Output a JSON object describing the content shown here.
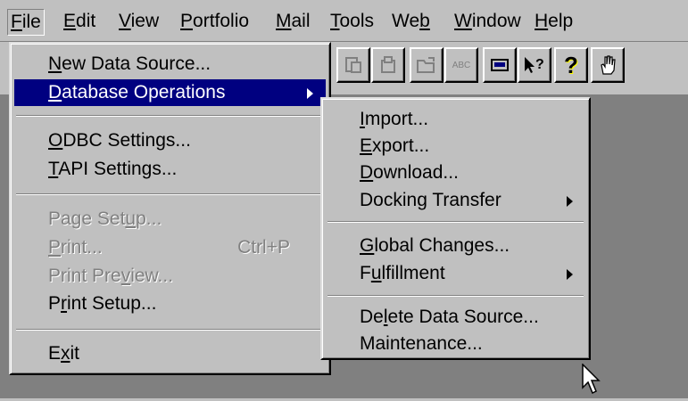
{
  "menubar": {
    "items": [
      {
        "label": "File",
        "underline": "F"
      },
      {
        "label": "Edit",
        "underline": "E"
      },
      {
        "label": "View",
        "underline": "V"
      },
      {
        "label": "Portfolio",
        "underline": "P"
      },
      {
        "label": "Mail",
        "underline": "M"
      },
      {
        "label": "Tools",
        "underline": "T"
      },
      {
        "label": "Web",
        "underline": "b"
      },
      {
        "label": "Window",
        "underline": "W"
      },
      {
        "label": "Help",
        "underline": "H"
      }
    ]
  },
  "toolbar": {
    "buttons": [
      "paste-icon",
      "copy-icon",
      "open-folder-icon",
      "spellcheck-icon",
      "print-icon",
      "context-help-icon",
      "help-icon",
      "hand-icon"
    ],
    "spellcheck_text": "ABC",
    "help_text": "?"
  },
  "file_menu": {
    "items": [
      {
        "label": "New Data Source...",
        "underline": "N",
        "state": "normal"
      },
      {
        "label": "Database Operations",
        "underline": "D",
        "state": "highlighted",
        "submenu": true
      },
      {
        "label": "ODBC Settings...",
        "underline": "O",
        "state": "normal"
      },
      {
        "label": "TAPI Settings...",
        "underline": "T",
        "state": "normal"
      },
      {
        "label": "Page Setup...",
        "underline": "u",
        "state": "disabled"
      },
      {
        "label": "Print...",
        "underline": "P",
        "state": "disabled",
        "shortcut": "Ctrl+P"
      },
      {
        "label": "Print Preview...",
        "underline": "v",
        "state": "disabled"
      },
      {
        "label": "Print Setup...",
        "underline": "r",
        "state": "normal"
      },
      {
        "label": "Exit",
        "underline": "x",
        "state": "normal"
      }
    ]
  },
  "db_submenu": {
    "items": [
      {
        "label": "Import...",
        "underline": "I"
      },
      {
        "label": "Export...",
        "underline": "E"
      },
      {
        "label": "Download...",
        "underline": "D"
      },
      {
        "label": "Docking Transfer",
        "underline": "",
        "submenu": true
      },
      {
        "label": "Global Changes...",
        "underline": "G"
      },
      {
        "label": "Fulfillment",
        "underline": "u",
        "submenu": true
      },
      {
        "label": "Delete Data Source...",
        "underline": "l"
      },
      {
        "label": "Maintenance...",
        "underline": ""
      }
    ]
  },
  "colors": {
    "face": "#c0c0c0",
    "workspace": "#808080",
    "highlight": "#000080"
  }
}
